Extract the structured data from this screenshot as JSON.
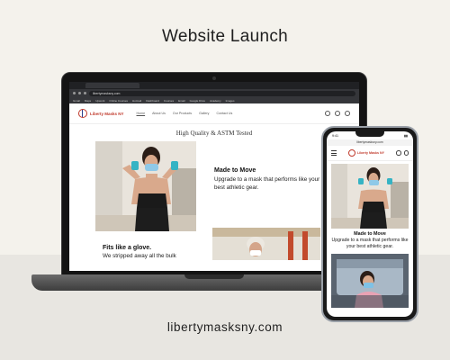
{
  "title": "Website Launch",
  "website_url": "libertymasksny.com",
  "laptop": {
    "address_bar": "libertymasksny.com",
    "bookmarks": [
      "Gmail",
      "Maps",
      "Upwork",
      "Online Courses",
      "Hotmail",
      "Dashboard",
      "Courses",
      "Email",
      "Google Drive",
      "Academy",
      "Images"
    ],
    "site": {
      "logo_text": "Liberty Masks NY",
      "nav": [
        "Home",
        "About Us",
        "Our Products",
        "Gallery",
        "Contact Us"
      ],
      "heading": "High Quality & ASTM Tested",
      "feature1_title": "Made to Move",
      "feature1_text": "Upgrade to a mask that performs like your best athletic gear.",
      "feature2_title": "Fits like a glove.",
      "feature2_text": "We stripped away all the bulk"
    }
  },
  "phone": {
    "time": "9:41",
    "url": "libertymasksny.com",
    "logo_text": "Liberty Masks NY",
    "feature_title": "Made to Move",
    "feature_text": "Upgrade to a mask that performs like your best athletic gear."
  },
  "colors": {
    "background": "#f4f2ec",
    "floor": "#e8e6e1",
    "brand_red": "#c0392b",
    "brand_blue": "#2c3e8c"
  }
}
